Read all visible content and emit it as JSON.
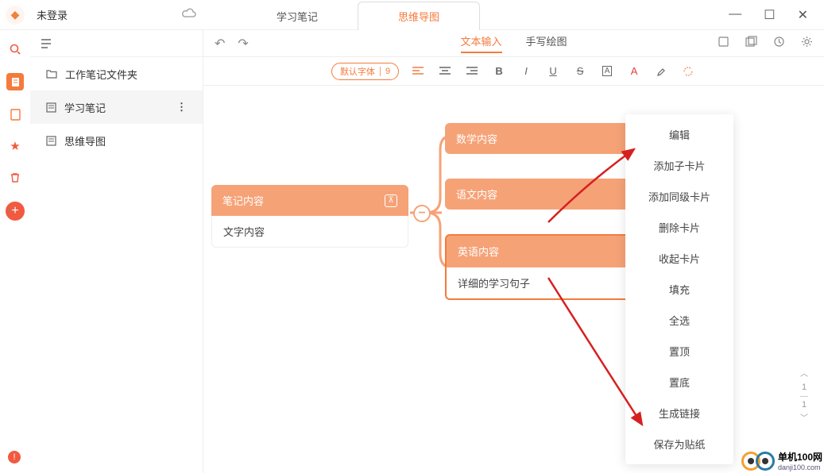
{
  "titlebar": {
    "login": "未登录"
  },
  "tabs": {
    "t1": "学习笔记",
    "t2": "思维导图"
  },
  "sidebar": {
    "items": [
      {
        "label": "工作笔记文件夹"
      },
      {
        "label": "学习笔记"
      },
      {
        "label": "思维导图"
      }
    ]
  },
  "toolbar": {
    "mode1": "文本输入",
    "mode2": "手写绘图",
    "font": "默认字体",
    "size": "9"
  },
  "nodes": {
    "root": {
      "title": "笔记内容",
      "body": "文字内容"
    },
    "n1": "数学内容",
    "n2": "语文内容",
    "n3": {
      "title": "英语内容",
      "body": "详细的学习句子"
    }
  },
  "context_menu": {
    "items": [
      "编辑",
      "添加子卡片",
      "添加同级卡片",
      "删除卡片",
      "收起卡片",
      "填充",
      "全选",
      "置顶",
      "置底",
      "生成链接",
      "保存为贴纸"
    ]
  },
  "page": {
    "current": "1",
    "total": "1"
  },
  "watermark": {
    "line1": "单机100网",
    "line2": "danji100.com"
  }
}
